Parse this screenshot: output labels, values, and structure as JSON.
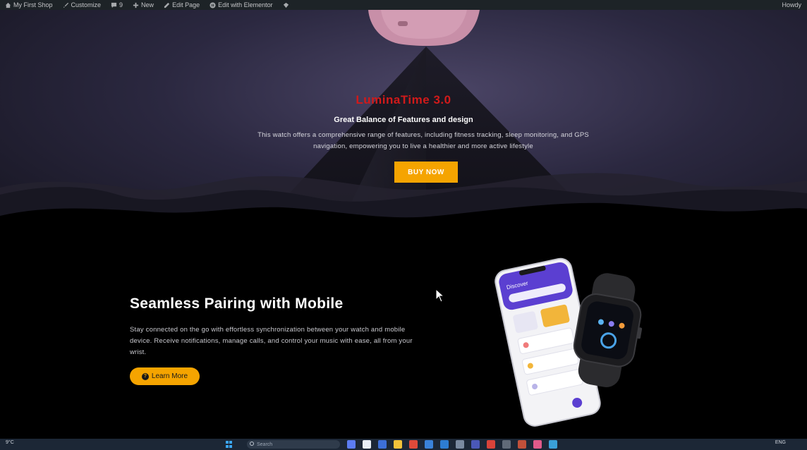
{
  "adminbar": {
    "items": [
      {
        "icon": "home-icon",
        "label": "My First Shop"
      },
      {
        "icon": "brush-icon",
        "label": "Customize"
      },
      {
        "icon": "comment-icon",
        "label": "9"
      },
      {
        "icon": "plus-icon",
        "label": "New"
      },
      {
        "icon": "pencil-icon",
        "label": "Edit Page"
      },
      {
        "icon": "elementor-icon",
        "label": "Edit with Elementor"
      },
      {
        "icon": "diamond-icon",
        "label": ""
      }
    ],
    "greeting": "Howdy"
  },
  "hero": {
    "title": "LuminaTime 3.0",
    "subtitle": "Great Balance of Features and design",
    "description": "This watch offers a comprehensive range of features, including fitness tracking, sleep monitoring, and GPS navigation, empowering you to live a healthier and more active lifestyle",
    "button": "BUY NOW",
    "title_color": "#d11a1a",
    "button_color": "#f5a400"
  },
  "pairing": {
    "title": "Seamless Pairing with Mobile",
    "description": "Stay connected on the go with effortless synchronization between your watch and mobile device. Receive notifications, manage calls, and control your music with ease, all from your wrist.",
    "button": "Learn More",
    "phone_screen_title": "Discover"
  },
  "taskbar": {
    "weather": "9°C",
    "search": "Search",
    "language": "ENG"
  }
}
